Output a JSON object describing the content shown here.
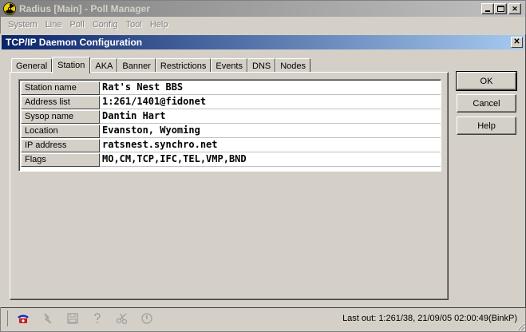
{
  "main_window": {
    "title": "Radius [Main] - Poll Manager",
    "menu": [
      "System",
      "Line",
      "Poll",
      "Config",
      "Tool",
      "Help"
    ]
  },
  "dialog": {
    "title": "TCP/IP Daemon  Configuration",
    "tabs": [
      {
        "label": "General",
        "active": false
      },
      {
        "label": "Station",
        "active": true
      },
      {
        "label": "AKA",
        "active": false
      },
      {
        "label": "Banner",
        "active": false
      },
      {
        "label": "Restrictions",
        "active": false
      },
      {
        "label": "Events",
        "active": false
      },
      {
        "label": "DNS",
        "active": false
      },
      {
        "label": "Nodes",
        "active": false
      }
    ],
    "fields": [
      {
        "label": "Station name",
        "value": "Rat's Nest BBS"
      },
      {
        "label": "Address list",
        "value": "1:261/1401@fidonet"
      },
      {
        "label": "Sysop name",
        "value": "Dantin Hart"
      },
      {
        "label": "Location",
        "value": "Evanston, Wyoming"
      },
      {
        "label": "IP address",
        "value": "ratsnest.synchro.net"
      },
      {
        "label": "Flags",
        "value": "MO,CM,TCP,IFC,TEL,VMP,BND"
      }
    ],
    "buttons": {
      "ok": "OK",
      "cancel": "Cancel",
      "help": "Help"
    }
  },
  "statusbar": {
    "text": "Last out: 1:261/38, 21/09/05 02:00:49(BinkP)",
    "icons": [
      "phone-icon",
      "lightning-icon",
      "disk-icon",
      "question-icon",
      "scissors-icon",
      "power-icon"
    ]
  },
  "colors": {
    "active_title_start": "#0a246a",
    "active_title_end": "#a6caf0",
    "inactive_title_start": "#808080",
    "inactive_title_end": "#c0c0c0",
    "face": "#d4d0c8"
  }
}
